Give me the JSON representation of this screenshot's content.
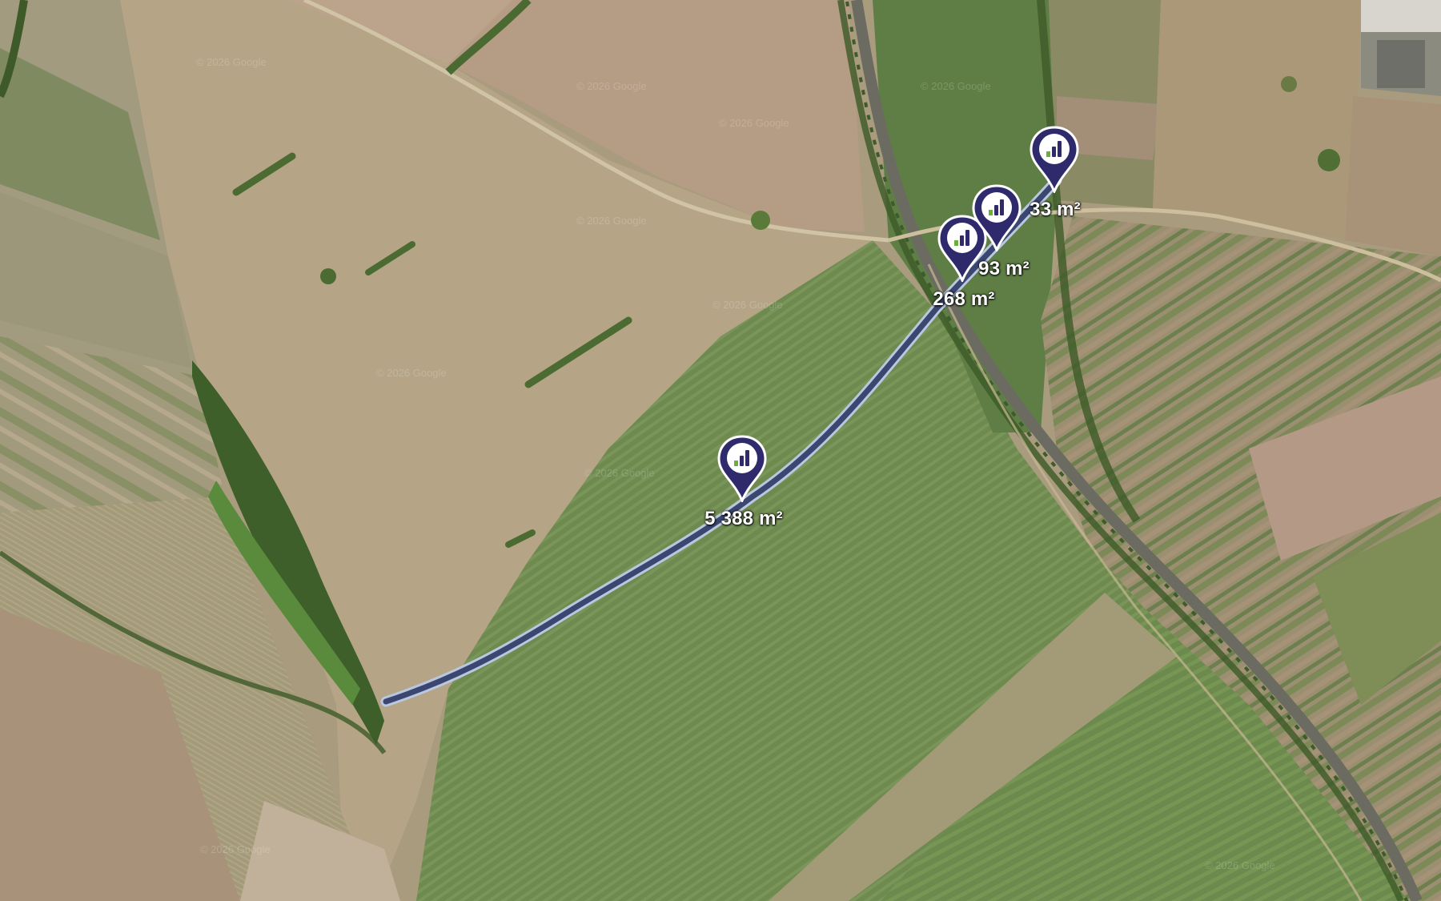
{
  "map": {
    "type": "satellite",
    "attribution_watermark": "© 2026 Google",
    "route_color": "#3b4770",
    "route_outline_color": "#b9c7df",
    "marker_color": "#2e2a6b",
    "marker_icon": "brand-logo-icon"
  },
  "parcels": [
    {
      "area": "5 388 m²"
    },
    {
      "area": "268 m²"
    },
    {
      "area": "93 m²"
    },
    {
      "area": "33 m²"
    }
  ]
}
